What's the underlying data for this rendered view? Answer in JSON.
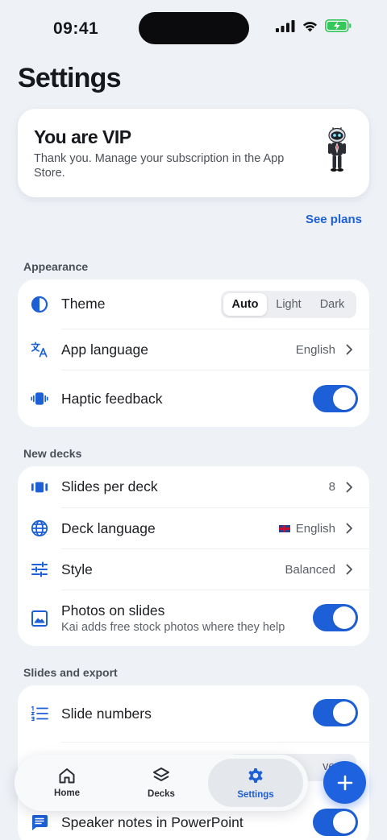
{
  "status": {
    "time": "09:41"
  },
  "page": {
    "title": "Settings"
  },
  "vip": {
    "title": "You are VIP",
    "subtitle": "Thank you. Manage your subscription in the App Store.",
    "see_plans": "See plans"
  },
  "appearance": {
    "section": "Appearance",
    "theme": {
      "label": "Theme",
      "options": [
        "Auto",
        "Light",
        "Dark"
      ],
      "selected": "Auto"
    },
    "app_language": {
      "label": "App language",
      "value": "English"
    },
    "haptic": {
      "label": "Haptic feedback",
      "on": true
    }
  },
  "new_decks": {
    "section": "New decks",
    "slides_per_deck": {
      "label": "Slides per deck",
      "value": "8"
    },
    "deck_language": {
      "label": "Deck language",
      "value": "English"
    },
    "style": {
      "label": "Style",
      "value": "Balanced"
    },
    "photos": {
      "label": "Photos on slides",
      "sublabel": "Kai adds free stock photos where they help",
      "on": true
    }
  },
  "slides_export": {
    "section": "Slides and export",
    "slide_numbers": {
      "label": "Slide numbers",
      "on": true
    },
    "partial_value": "verP",
    "speaker_notes": {
      "label": "Speaker notes in PowerPoint",
      "on": true
    }
  },
  "tabbar": {
    "tabs": [
      {
        "label": "Home",
        "icon": "home-icon"
      },
      {
        "label": "Decks",
        "icon": "layers-icon"
      },
      {
        "label": "Settings",
        "icon": "gear-icon"
      }
    ],
    "active": "Settings"
  },
  "fab": {
    "icon": "plus-icon"
  },
  "colors": {
    "accent": "#1d5fd6",
    "background": "#eef1f6",
    "card": "#ffffff"
  }
}
